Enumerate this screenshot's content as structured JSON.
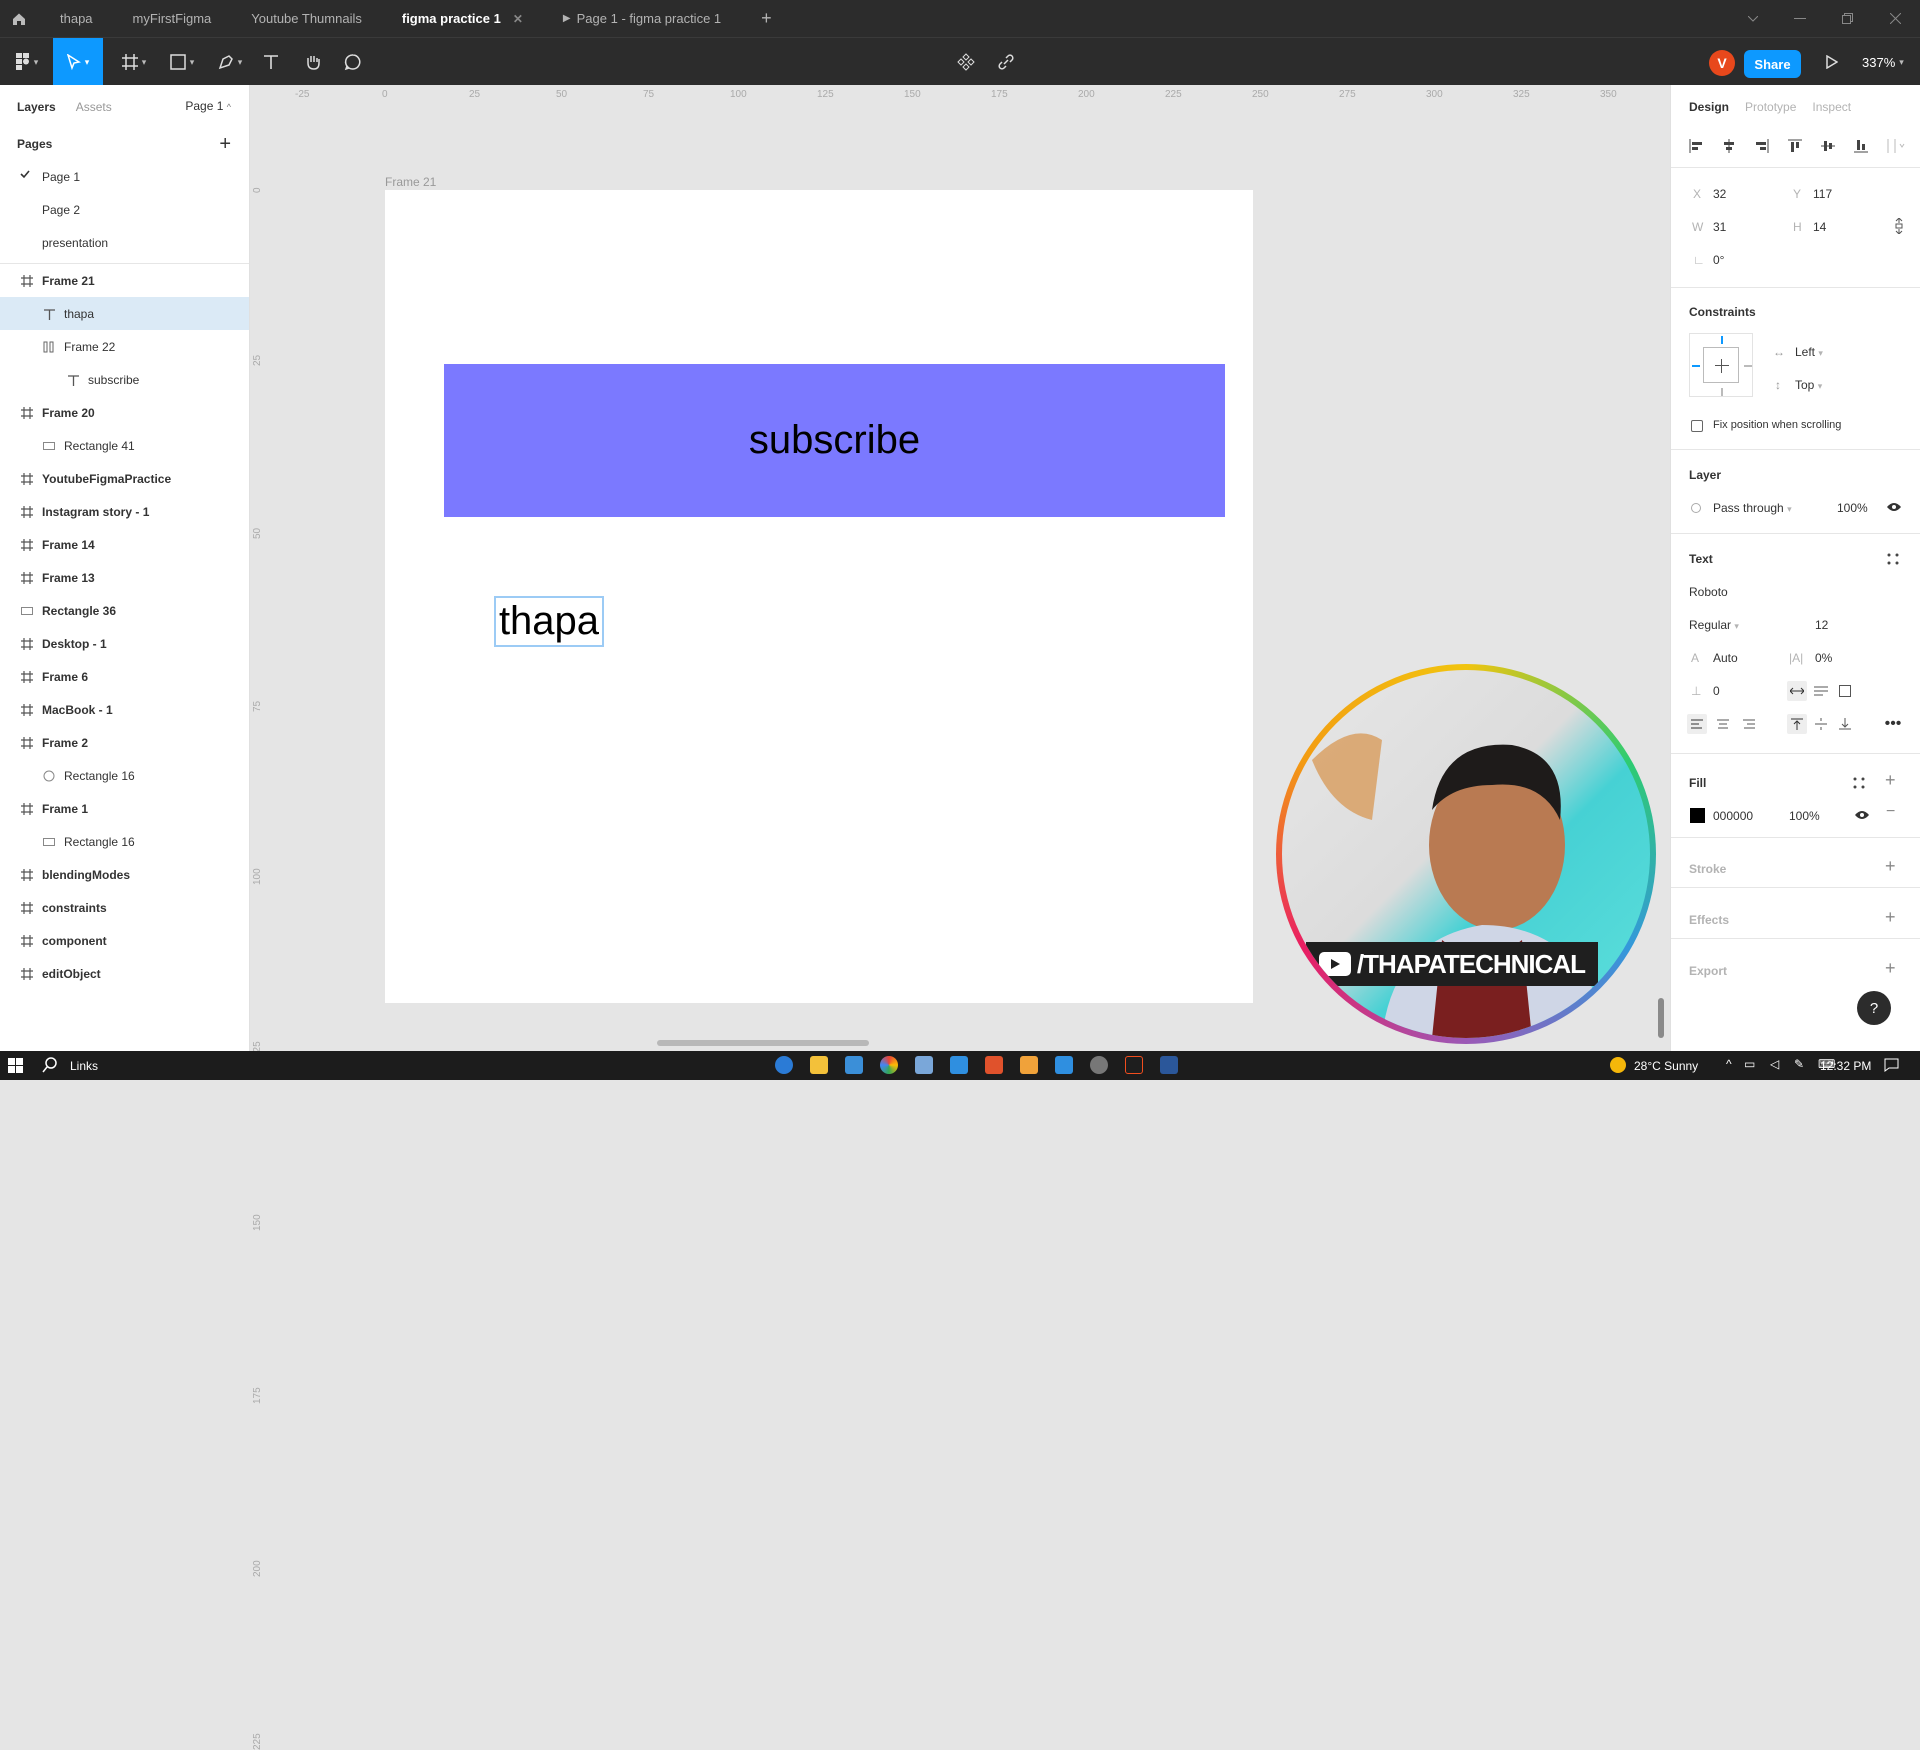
{
  "tabs": {
    "items": [
      {
        "label": "thapa",
        "active": false
      },
      {
        "label": "myFirstFigma",
        "active": false
      },
      {
        "label": "Youtube Thumnails",
        "active": false
      },
      {
        "label": "figma practice 1",
        "active": true
      },
      {
        "label": "Page 1 - figma practice 1",
        "active": false
      }
    ],
    "add": "+"
  },
  "toolbar": {
    "avatar_initial": "V",
    "share_label": "Share",
    "zoom": "337%"
  },
  "left_panel": {
    "tab_layers": "Layers",
    "tab_assets": "Assets",
    "page_selector": "Page 1",
    "pages_header": "Pages",
    "pages": [
      {
        "label": "Page 1",
        "checked": true
      },
      {
        "label": "Page 2",
        "checked": false
      },
      {
        "label": "presentation",
        "checked": false
      }
    ],
    "layers": [
      {
        "label": "Frame 21",
        "icon": "frame-icon",
        "level": 0
      },
      {
        "label": "thapa",
        "icon": "text-icon",
        "level": 1,
        "selected": true
      },
      {
        "label": "Frame 22",
        "icon": "autolayout-icon",
        "level": 1
      },
      {
        "label": "subscribe",
        "icon": "text-icon",
        "level": 2
      },
      {
        "label": "Frame 20",
        "icon": "frame-icon",
        "level": 0
      },
      {
        "label": "Rectangle 41",
        "icon": "rectangle-icon",
        "level": 1
      },
      {
        "label": "YoutubeFigmaPractice",
        "icon": "frame-icon",
        "level": 0
      },
      {
        "label": "Instagram story - 1",
        "icon": "frame-icon",
        "level": 0
      },
      {
        "label": "Frame 14",
        "icon": "frame-icon",
        "level": 0
      },
      {
        "label": "Frame 13",
        "icon": "frame-icon",
        "level": 0
      },
      {
        "label": "Rectangle 36",
        "icon": "rectangle-icon",
        "level": 0
      },
      {
        "label": "Desktop - 1",
        "icon": "frame-icon",
        "level": 0
      },
      {
        "label": "Frame 6",
        "icon": "frame-icon",
        "level": 0
      },
      {
        "label": "MacBook - 1",
        "icon": "frame-icon",
        "level": 0
      },
      {
        "label": "Frame 2",
        "icon": "frame-icon",
        "level": 0
      },
      {
        "label": "Rectangle 16",
        "icon": "ellipse-icon",
        "level": 1
      },
      {
        "label": "Frame 1",
        "icon": "frame-icon",
        "level": 0
      },
      {
        "label": "Rectangle 16",
        "icon": "rectangle-icon",
        "level": 1
      },
      {
        "label": "blendingModes",
        "icon": "frame-icon",
        "level": 0
      },
      {
        "label": "constraints",
        "icon": "frame-icon",
        "level": 0
      },
      {
        "label": "component",
        "icon": "frame-icon",
        "level": 0
      },
      {
        "label": "editObject",
        "icon": "frame-icon",
        "level": 0
      }
    ]
  },
  "rulers": {
    "top": [
      "-25",
      "0",
      "25",
      "50",
      "75",
      "100",
      "125",
      "150",
      "175",
      "200",
      "225",
      "250",
      "275",
      "300",
      "325",
      "350"
    ],
    "left": [
      "0",
      "25",
      "50",
      "75",
      "100",
      "125",
      "150",
      "175",
      "200",
      "225"
    ]
  },
  "canvas": {
    "frame_label": "Frame 21",
    "banner_text": "subscribe",
    "banner_color": "#7B79FF",
    "selected_text": "thapa"
  },
  "webcam": {
    "channel": "/THAPATECHNICAL"
  },
  "right_panel": {
    "tab_design": "Design",
    "tab_prototype": "Prototype",
    "tab_inspect": "Inspect",
    "x_label": "X",
    "x_value": "32",
    "y_label": "Y",
    "y_value": "117",
    "w_label": "W",
    "w_value": "31",
    "h_label": "H",
    "h_value": "14",
    "rotation": "0°",
    "constraints_header": "Constraints",
    "constraint_h": "Left",
    "constraint_v": "Top",
    "fix_position": "Fix position when scrolling",
    "layer_header": "Layer",
    "blend_mode": "Pass through",
    "layer_opacity": "100%",
    "text_header": "Text",
    "font_family": "Roboto",
    "font_weight": "Regular",
    "font_size": "12",
    "line_height": "Auto",
    "letter_spacing": "0%",
    "paragraph_spacing": "0",
    "fill_header": "Fill",
    "fill_hex": "000000",
    "fill_opacity": "100%",
    "fill_color": "#000000",
    "stroke_header": "Stroke",
    "effects_header": "Effects",
    "export_header": "Export",
    "help": "?"
  },
  "taskbar": {
    "search_label": "Links",
    "weather": "28°C  Sunny",
    "time": "12:32 PM"
  }
}
